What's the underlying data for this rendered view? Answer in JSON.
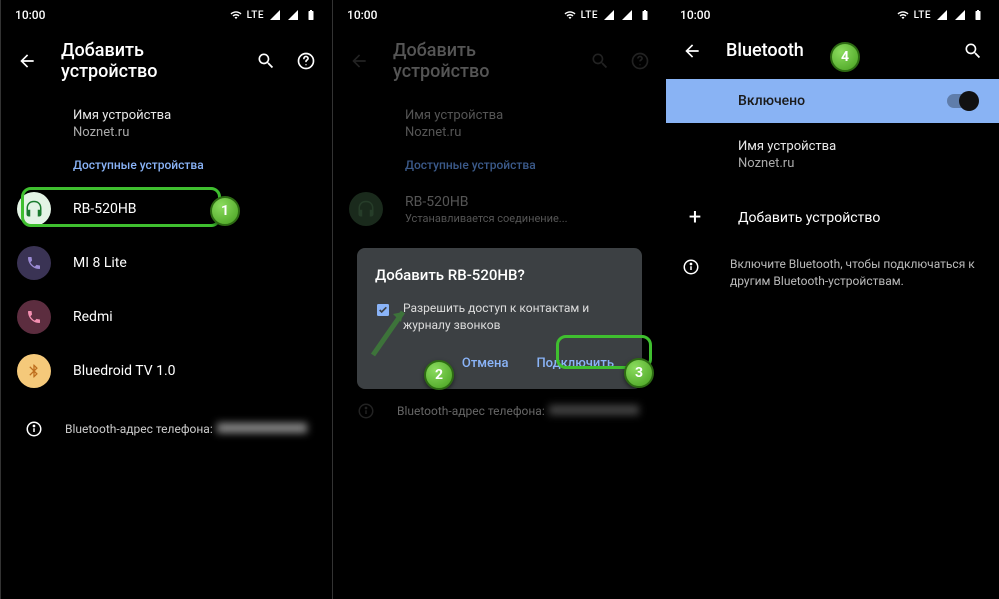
{
  "status": {
    "time": "10:00",
    "network": "LTE"
  },
  "screen1": {
    "title": "Добавить устройство",
    "deviceNameLabel": "Имя устройства",
    "deviceNameValue": "Noznet.ru",
    "availableLabel": "Доступные устройства",
    "devices": [
      {
        "name": "RB-520HB"
      },
      {
        "name": "MI 8 Lite"
      },
      {
        "name": "Redmi"
      },
      {
        "name": "Bluedroid TV 1.0"
      }
    ],
    "btAddressLabel": "Bluetooth-адрес телефона:"
  },
  "screen2": {
    "title": "Добавить устройство",
    "deviceNameLabel": "Имя устройства",
    "deviceNameValue": "Noznet.ru",
    "availableLabel": "Доступные устройства",
    "connectingDevice": "RB-520HB",
    "connectingStatus": "Устанавливается соединение...",
    "dialogTitle": "Добавить RB-520HB?",
    "dialogCheckLabel": "Разрешить доступ к контактам и журналу звонков",
    "cancel": "Отмена",
    "connect": "Подключить",
    "btAddressLabel": "Bluetooth-адрес телефона:"
  },
  "screen3": {
    "title": "Bluetooth",
    "toggleLabel": "Включено",
    "deviceNameLabel": "Имя устройства",
    "deviceNameValue": "Noznet.ru",
    "addDevice": "Добавить устройство",
    "infoText": "Включите Bluetooth, чтобы подключаться к другим Bluetooth-устройствам."
  }
}
